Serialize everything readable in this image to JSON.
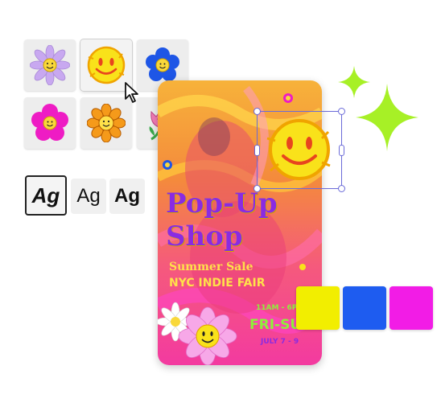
{
  "stickers": [
    {
      "name": "lavender-daisy-smiley",
      "petal": "#c8a8f0",
      "center": "#f9d83a",
      "selected": false
    },
    {
      "name": "yellow-smiley",
      "petal": "#f9e21a",
      "center": "#f9e21a",
      "selected": true
    },
    {
      "name": "blue-flower-smiley",
      "petal": "#1e56e6",
      "center": "#f9d83a",
      "selected": false
    },
    {
      "name": "magenta-flower-smiley",
      "petal": "#ee1cc4",
      "center": "#f9d83a",
      "selected": false
    },
    {
      "name": "orange-sunflower-smiley",
      "petal": "#f59a1a",
      "center": "#ffe14a",
      "selected": false
    },
    {
      "name": "pink-tulip-character",
      "petal": "#f07ab6",
      "center": "#3aa84a",
      "selected": false
    }
  ],
  "font_styles": [
    {
      "label": "Ag",
      "style": "bold-italic",
      "selected": true
    },
    {
      "label": "Ag",
      "style": "regular",
      "selected": false
    },
    {
      "label": "Ag",
      "style": "bold",
      "selected": false
    }
  ],
  "poster": {
    "title_line1": "Pop-Up",
    "title_line2": "Shop",
    "subtitle": "Summer Sale",
    "event": "NYC INDIE FAIR",
    "hours": "11AM - 6PM",
    "days": "FRI-SUN",
    "dates": "JULY 7 - 9"
  },
  "swatches": [
    {
      "name": "yellow",
      "color": "#f2ee00"
    },
    {
      "name": "blue",
      "color": "#1e5cf0"
    },
    {
      "name": "magenta",
      "color": "#f21ce6"
    }
  ],
  "colors": {
    "sparkle": "#a7f026",
    "selection": "#6a6ad8",
    "title": "#8a2be2",
    "subtitle": "#ffe14a",
    "accent_green": "#8ef03a"
  }
}
